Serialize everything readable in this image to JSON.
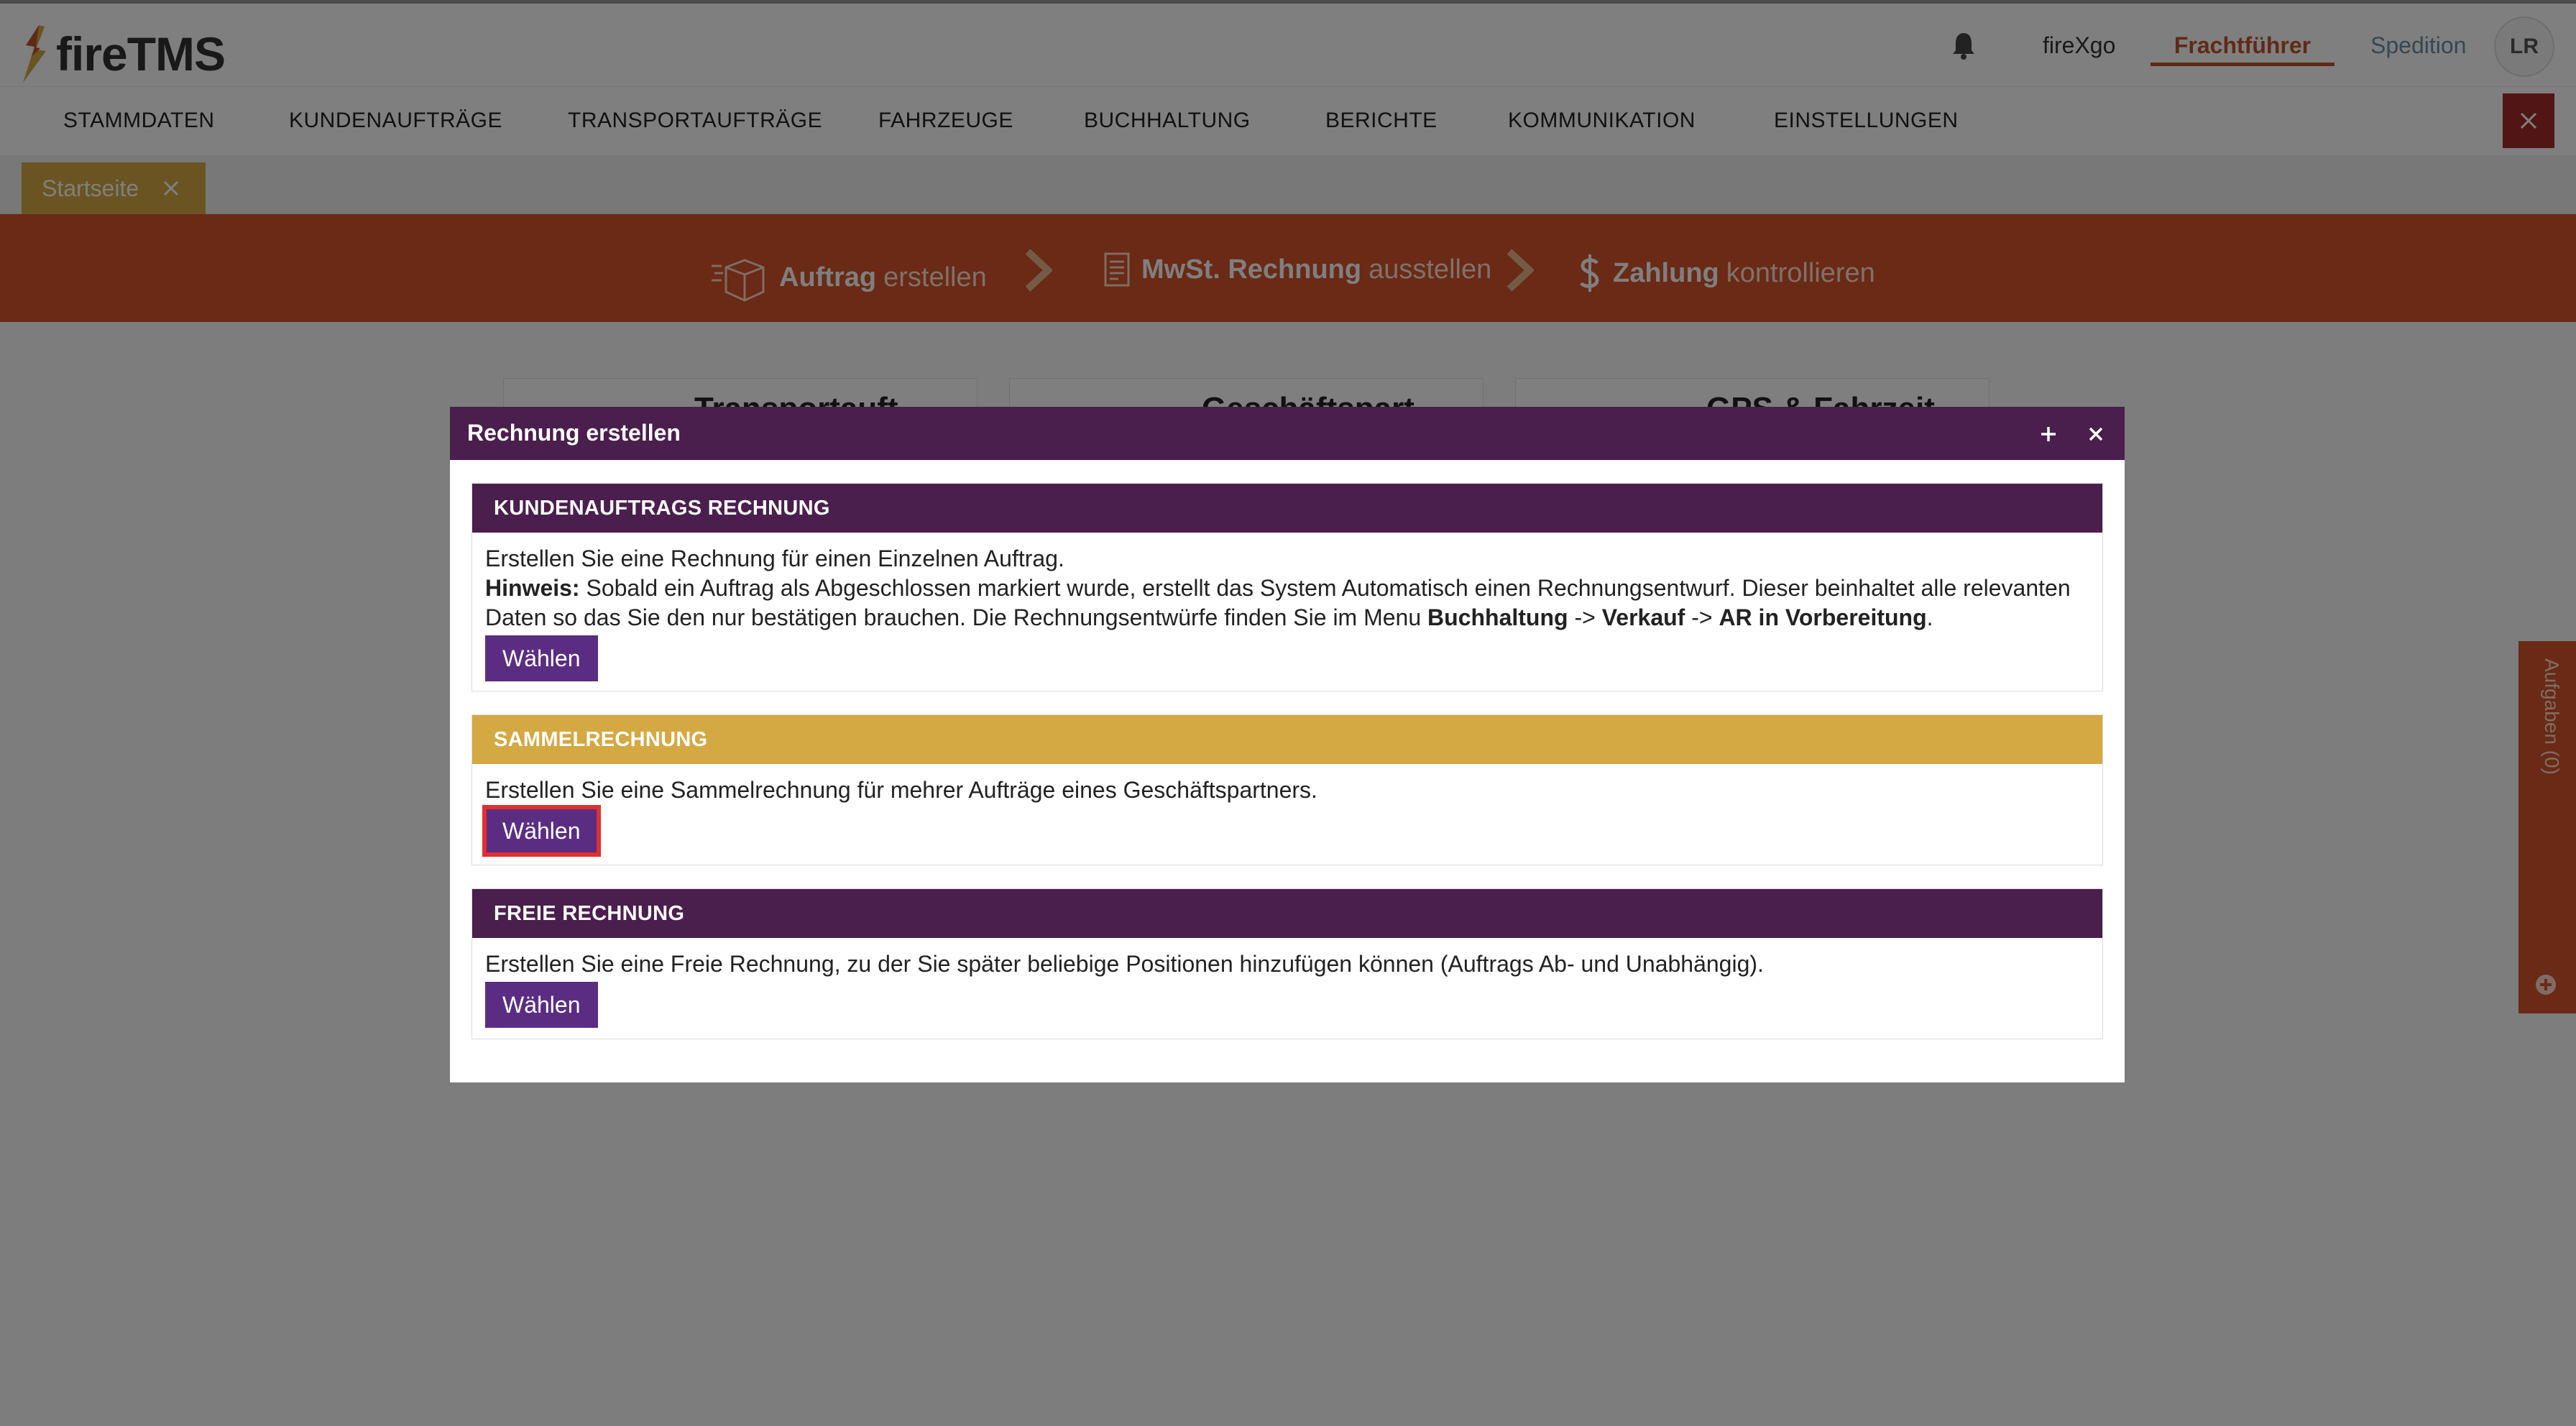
{
  "header": {
    "logo_text": "fireTMS",
    "user_name": "fireXgo",
    "active_mode": "Frachtführer",
    "other_mode": "Spedition",
    "avatar_initials": "LR",
    "icons": {
      "notification": "bell-icon",
      "logo": "flame-logo-icon"
    }
  },
  "nav": {
    "items": [
      "STAMMDATEN",
      "KUNDENAUFTRÄGE",
      "TRANSPORTAUFTRÄGE",
      "FAHRZEUGE",
      "BUCHHALTUNG",
      "BERICHTE",
      "KOMMUNIKATION",
      "EINSTELLUNGEN"
    ],
    "close_icon": "close-icon"
  },
  "tabs": [
    {
      "label": "Startseite",
      "close_icon": "close-icon"
    }
  ],
  "workflow": {
    "steps": [
      {
        "strong": "Auftrag",
        "light": "erstellen",
        "icon": "package-icon"
      },
      {
        "strong": "MwSt. Rechnung",
        "light": "ausstellen",
        "icon": "invoice-icon"
      },
      {
        "strong": "Zahlung",
        "light": "kontrollieren",
        "icon": "dollar-icon"
      }
    ]
  },
  "background_cards": {
    "titles": [
      "Transportauft",
      "Geschäftspart",
      "GPS & Fahrzeit"
    ]
  },
  "side_panel": {
    "label": "Aufgaben (0)",
    "icon": "plus-circle-icon"
  },
  "modal": {
    "title": "Rechnung erstellen",
    "plus_icon": "plus-icon",
    "close_icon": "close-icon",
    "sections": [
      {
        "heading": "KUNDENAUFTRAGS RECHNUNG",
        "text": "Erstellen Sie eine Rechnung für einen Einzelnen Auftrag.",
        "hint_label": "Hinweis:",
        "hint_text": " Sobald ein Auftrag als Abgeschlossen markiert wurde, erstellt das System Automatisch einen Rechnungsentwurf. Dieser beinhaltet alle relevanten Daten so das Sie den nur bestätigen brauchen. Die Rechnungsentwürfe finden Sie im Menu ",
        "path_1": "Buchhaltung",
        "arrow_1": " -> ",
        "path_2": "Verkauf",
        "arrow_2": " -> ",
        "path_3": "AR in Vorbereitung",
        "path_end": ".",
        "button": "Wählen"
      },
      {
        "heading": "SAMMELRECHNUNG",
        "text": "Erstellen Sie eine Sammelrechnung für mehrer Aufträge eines Geschäftspartners.",
        "button": "Wählen"
      },
      {
        "heading": "FREIE RECHNUNG",
        "text": "Erstellen Sie eine Freie Rechnung, zu der Sie später beliebige Positionen hinzufügen können (Auftrags Ab- und Unabhängig).",
        "button": "Wählen"
      }
    ]
  },
  "colors": {
    "brand_orange": "#d4552a",
    "modal_purple": "#4a1e4d",
    "gold": "#d4a843",
    "button_purple": "#5a2d82",
    "focus_red": "#e03030"
  }
}
